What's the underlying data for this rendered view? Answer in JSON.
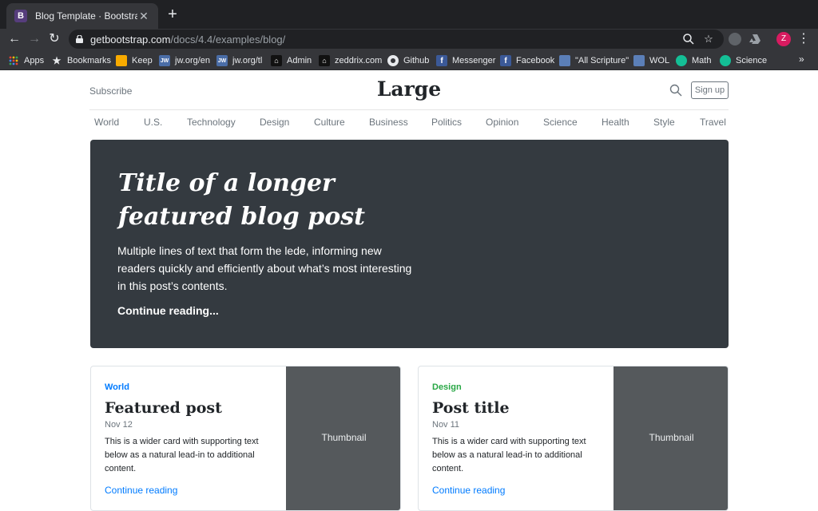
{
  "browser": {
    "tab": {
      "favicon": "B",
      "title": "Blog Template · Bootstrap",
      "close": "✕"
    },
    "new_tab": "+",
    "url": {
      "host": "getbootstrap.com",
      "path": "/docs/4.4/examples/blog/"
    },
    "profile_initial": "Z",
    "bookmarks": [
      {
        "label": "Apps",
        "icon": "apps-grid-icon"
      },
      {
        "label": "Bookmarks",
        "icon": "star-icon"
      },
      {
        "label": "Keep",
        "icon": "keep-icon",
        "color": "#f9ab00"
      },
      {
        "label": "jw.org/en",
        "icon": "JW",
        "color": "#4a6da7"
      },
      {
        "label": "jw.org/tl",
        "icon": "JW",
        "color": "#4a6da7"
      },
      {
        "label": "Admin",
        "icon": "house-icon"
      },
      {
        "label": "zeddrix.com",
        "icon": "house-icon"
      },
      {
        "label": "Github",
        "icon": "github-icon"
      },
      {
        "label": "Messenger",
        "icon": "f",
        "color": "#3b5998"
      },
      {
        "label": "Facebook",
        "icon": "f",
        "color": "#3b5998"
      },
      {
        "label": "\"All Scripture\"",
        "icon": "book-icon",
        "color": "#5b7fb8"
      },
      {
        "label": "WOL",
        "icon": "book-icon",
        "color": "#5b7fb8"
      },
      {
        "label": "Math",
        "icon": "khan-icon",
        "color": "#14bf96"
      },
      {
        "label": "Science",
        "icon": "khan-icon",
        "color": "#14bf96"
      }
    ],
    "bookmarks_overflow": "»"
  },
  "header": {
    "subscribe": "Subscribe",
    "logo": "Large",
    "signup": "Sign up"
  },
  "nav": [
    "World",
    "U.S.",
    "Technology",
    "Design",
    "Culture",
    "Business",
    "Politics",
    "Opinion",
    "Science",
    "Health",
    "Style",
    "Travel"
  ],
  "jumbotron": {
    "title": "Title of a longer featured blog post",
    "lede": "Multiple lines of text that form the lede, informing new readers quickly and efficiently about what’s most interesting in this post’s contents.",
    "link": "Continue reading..."
  },
  "cards": [
    {
      "category": "World",
      "category_color": "#007bff",
      "title": "Featured post",
      "date": "Nov 12",
      "text": "This is a wider card with supporting text below as a natural lead-in to additional content.",
      "link": "Continue reading",
      "thumbnail": "Thumbnail"
    },
    {
      "category": "Design",
      "category_color": "#28a745",
      "title": "Post title",
      "date": "Nov 11",
      "text": "This is a wider card with supporting text below as a natural lead-in to additional content.",
      "link": "Continue reading",
      "thumbnail": "Thumbnail"
    }
  ]
}
